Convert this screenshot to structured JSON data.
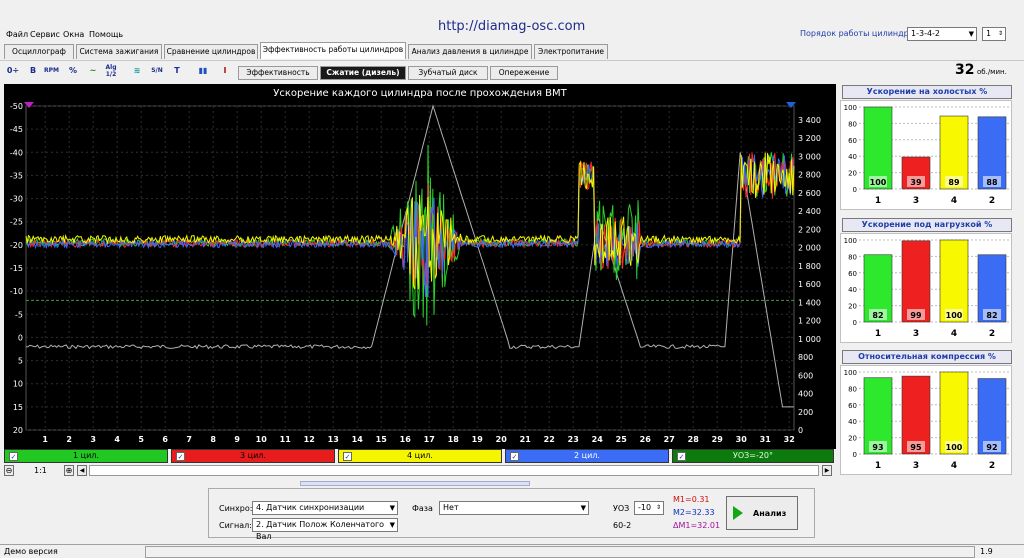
{
  "menu": [
    "Файл",
    "Сервис",
    "Окна",
    "Помощь"
  ],
  "url": "http://diamag-osc.com",
  "firing": {
    "label": "Порядок работы цилиндров",
    "order": "1-3-4-2",
    "num": "1"
  },
  "tabs": [
    "Осциллограф",
    "Система зажигания",
    "Сравнение цилиндров",
    "Эффективность работы цилиндров",
    "Анализ давления в цилиндре",
    "Электропитание"
  ],
  "toolbar": {
    "icons": [
      "0÷",
      "B",
      "RPM",
      "%",
      "~",
      "Alg 1/2",
      "≋",
      "S/N",
      "T",
      "▮▮",
      "I"
    ]
  },
  "subtabs": [
    "Эффективность",
    "Сжатие (дизель)",
    "Зубчатый диск",
    "Опережение"
  ],
  "rpm": {
    "value": "32",
    "unit": "об./мин."
  },
  "chart": {
    "title": "Ускорение каждого цилиндра после прохождения ВМТ"
  },
  "chart_data": {
    "type": "line",
    "title": "Ускорение каждого цилиндра после прохождения ВМТ",
    "x_ticks": [
      "1",
      "2",
      "3",
      "4",
      "5",
      "6",
      "7",
      "8",
      "9",
      "10",
      "11",
      "12",
      "13",
      "14",
      "15",
      "16",
      "17",
      "18",
      "19",
      "20",
      "21",
      "22",
      "23",
      "24",
      "25",
      "26",
      "27",
      "28",
      "29",
      "30",
      "31",
      "32"
    ],
    "left_ticks": [
      "-50",
      "-45",
      "-40",
      "-35",
      "-30",
      "-25",
      "-20",
      "-15",
      "-10",
      "-5",
      "0",
      "5",
      "10",
      "15",
      "20"
    ],
    "right_ticks": [
      "3 400",
      "3 200",
      "3 000",
      "2 800",
      "2 600",
      "2 400",
      "2 200",
      "2 000",
      "1 800",
      "1 600",
      "1 400",
      "1 200",
      "1 000",
      "800",
      "600",
      "400",
      "200",
      "0"
    ],
    "ylim_left": [
      -50,
      20
    ],
    "ylim_right": [
      0,
      3500
    ]
  },
  "legend": [
    {
      "label": "1 цил.",
      "color": "#1ec81e"
    },
    {
      "label": "3 цил.",
      "color": "#ee1c1c"
    },
    {
      "label": "4 цил.",
      "color": "#f5f500"
    },
    {
      "label": "2 цил.",
      "color": "#3a6cf5"
    },
    {
      "label": "УОЗ=-20°",
      "color": "#0c7a0c"
    }
  ],
  "zoom": "1:1",
  "panels": [
    {
      "title": "Ускорение на холостых %",
      "ticks": [
        "100",
        "80",
        "60",
        "40",
        "20",
        "0"
      ],
      "bars": [
        {
          "cyl": "1",
          "value": 100,
          "label": "100",
          "color": "#2ee82e"
        },
        {
          "cyl": "3",
          "value": 39,
          "label": "39",
          "color": "#ee2020"
        },
        {
          "cyl": "4",
          "value": 89,
          "label": "89",
          "color": "#f8f800"
        },
        {
          "cyl": "2",
          "value": 88,
          "label": "88",
          "color": "#3a6cf5"
        }
      ]
    },
    {
      "title": "Ускорение под нагрузкой %",
      "ticks": [
        "100",
        "80",
        "60",
        "40",
        "20",
        "0"
      ],
      "bars": [
        {
          "cyl": "1",
          "value": 82,
          "label": "82",
          "color": "#2ee82e"
        },
        {
          "cyl": "3",
          "value": 99,
          "label": "99",
          "color": "#ee2020"
        },
        {
          "cyl": "4",
          "value": 100,
          "label": "100",
          "color": "#f8f800"
        },
        {
          "cyl": "2",
          "value": 82,
          "label": "82",
          "color": "#3a6cf5"
        }
      ]
    },
    {
      "title": "Относительная компрессия %",
      "ticks": [
        "100",
        "80",
        "60",
        "40",
        "20",
        "0"
      ],
      "bars": [
        {
          "cyl": "1",
          "value": 93,
          "label": "93",
          "color": "#2ee82e"
        },
        {
          "cyl": "3",
          "value": 95,
          "label": "95",
          "color": "#ee2020"
        },
        {
          "cyl": "4",
          "value": 100,
          "label": "100",
          "color": "#f8f800"
        },
        {
          "cyl": "2",
          "value": 92,
          "label": "92",
          "color": "#3a6cf5"
        }
      ]
    }
  ],
  "bottom": {
    "sync_label": "Синхро:",
    "sync_value": "4. Датчик синхронизации",
    "signal_label": "Сигнал:",
    "signal_value": "2. Датчик Полож Коленчатого Вал",
    "phase_label": "Фаза",
    "phase_value": "Нет",
    "uoz_label": "УОЗ",
    "uoz_value": "-10",
    "wheel": "60-2",
    "m1": "M1=0.31",
    "m2": "M2=32.33",
    "dm": "ΔM1=32.01",
    "analyze": "Анализ"
  },
  "status": {
    "text": "Демо версия",
    "version": "1.9"
  }
}
